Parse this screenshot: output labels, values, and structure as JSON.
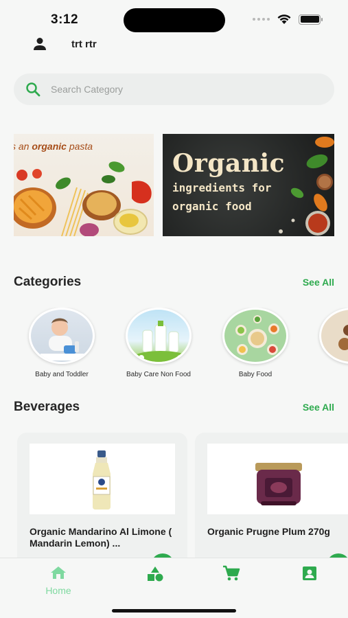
{
  "status_bar": {
    "time": "3:12"
  },
  "header": {
    "user_name": "trt rtr"
  },
  "search": {
    "placeholder": "Search Category"
  },
  "banners": {
    "pasta": {
      "prefix": "s an ",
      "highlight": "organic",
      "suffix": " pasta"
    },
    "organic": {
      "title": "Organic",
      "line1": "ingredients for",
      "line2": "organic food"
    }
  },
  "categories_section": {
    "title": "Categories",
    "see_all": "See All",
    "items": [
      {
        "label": "Baby and Toddler"
      },
      {
        "label": "Baby Care Non Food"
      },
      {
        "label": "Baby Food"
      }
    ]
  },
  "beverages_section": {
    "title": "Beverages",
    "see_all": "See All",
    "products": [
      {
        "title": "Organic Mandarino Al Limone ( Mandarin Lemon) ..."
      },
      {
        "title": "Organic Prugne Plum 270g"
      }
    ]
  },
  "bottom_nav": {
    "home_label": "Home"
  },
  "colors": {
    "accent": "#2eaa4e",
    "accent_light": "#7fd9a0",
    "background": "#f6f7f6"
  }
}
